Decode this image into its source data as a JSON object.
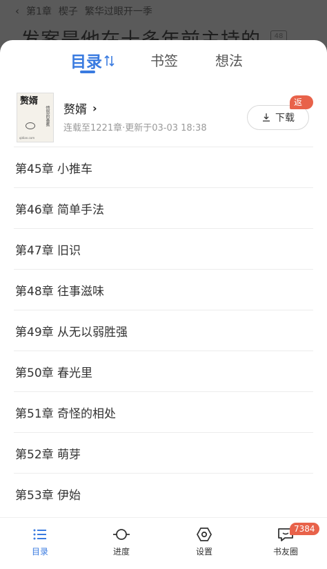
{
  "background": {
    "chapter_label": "第1章",
    "chapter_title": "楔子",
    "chapter_subtitle": "繁华过眼开一季",
    "body_text": "发案是他在十多年前主持的",
    "page_badge": "48"
  },
  "tabs": [
    {
      "label": "目录",
      "active": true
    },
    {
      "label": "书签",
      "active": false
    },
    {
      "label": "想法",
      "active": false
    }
  ],
  "book": {
    "cover_title": "赘婿",
    "cover_author": "愤怒的香蕉",
    "cover_url": "qidian.com",
    "title": "赘婿",
    "meta": "连载至1221章·更新于03-03 18:38",
    "download_label": "下载",
    "rebate_badge": "返币"
  },
  "chapters": [
    "第45章 小推车",
    "第46章 简单手法",
    "第47章 旧识",
    "第48章 往事滋味",
    "第49章 从无以弱胜强",
    "第50章 春光里",
    "第51章 奇怪的相处",
    "第52章 萌芽",
    "第53章 伊始"
  ],
  "bottom_nav": {
    "toc": "目录",
    "progress": "进度",
    "settings": "设置",
    "friends": "书友圈",
    "friends_badge": "7384"
  },
  "colors": {
    "accent": "#3a7be0",
    "badge": "#e8624a"
  }
}
